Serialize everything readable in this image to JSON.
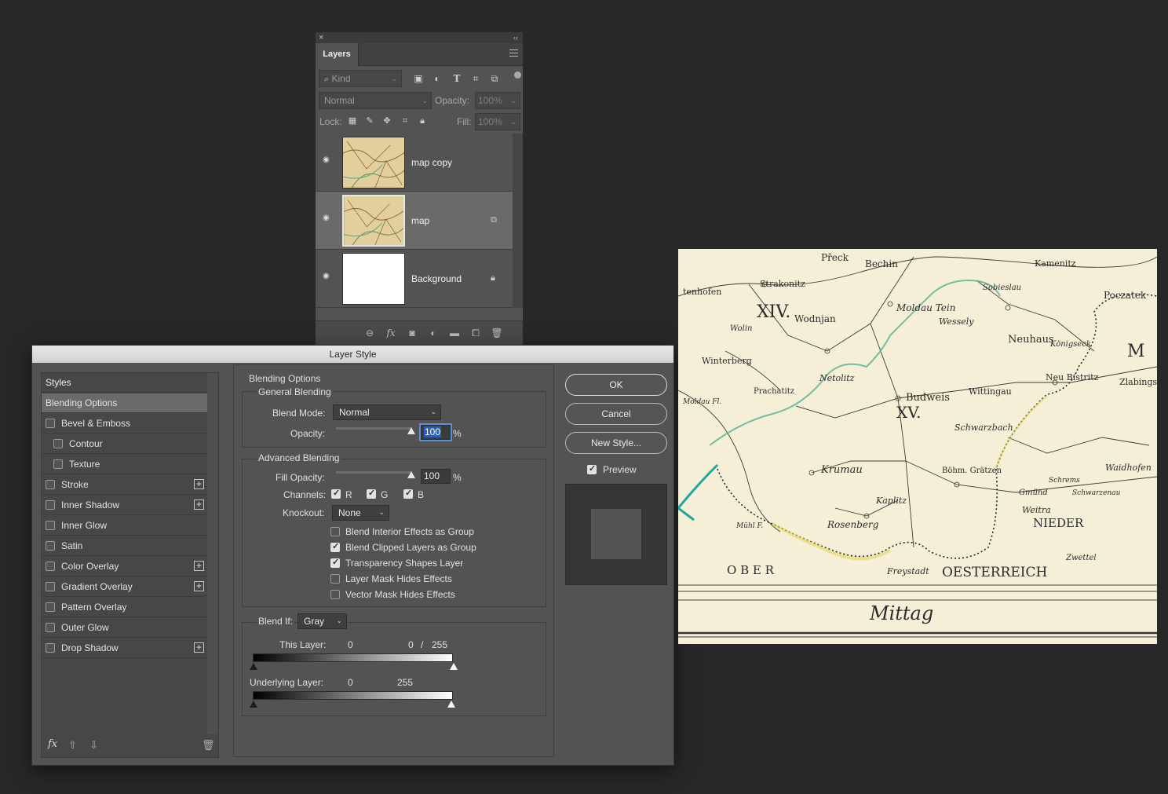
{
  "layers_panel": {
    "close_glyph": "×",
    "collapse_glyph": "‹‹",
    "tab_label": "Layers",
    "filter": {
      "label": "Kind",
      "icons": [
        "image-filter-icon",
        "adjustment-filter-icon",
        "type-filter-icon",
        "shape-filter-icon",
        "smart-object-filter-icon"
      ]
    },
    "blend_mode": "Normal",
    "opacity_label": "Opacity:",
    "opacity_value": "100%",
    "lock_label": "Lock:",
    "lock_icons": [
      "lock-transparent-pixels-icon",
      "lock-image-pixels-icon",
      "lock-position-icon",
      "lock-artboard-icon",
      "lock-all-icon"
    ],
    "fill_label": "Fill:",
    "fill_value": "100%",
    "layers": [
      {
        "name": "map copy",
        "visible": true,
        "selected": false,
        "thumb": "map"
      },
      {
        "name": "map",
        "visible": true,
        "selected": true,
        "thumb": "map",
        "badge": "smart-object-icon"
      },
      {
        "name": "Background",
        "visible": true,
        "selected": false,
        "thumb": "white",
        "badge": "lock-icon"
      }
    ],
    "footer_icons": [
      "link-layers-icon",
      "fx-icon",
      "add-mask-icon",
      "new-adjustment-icon",
      "new-group-icon",
      "new-layer-icon",
      "delete-layer-icon"
    ]
  },
  "layer_style": {
    "title": "Layer Style",
    "styles": [
      {
        "label": "Styles",
        "type": "header"
      },
      {
        "label": "Blending Options",
        "type": "active"
      },
      {
        "label": "Bevel & Emboss",
        "checkbox": true,
        "checked": false
      },
      {
        "label": "Contour",
        "checkbox": true,
        "checked": false,
        "indent": true
      },
      {
        "label": "Texture",
        "checkbox": true,
        "checked": false,
        "indent": true
      },
      {
        "label": "Stroke",
        "checkbox": true,
        "checked": false,
        "plus": true
      },
      {
        "label": "Inner Shadow",
        "checkbox": true,
        "checked": false,
        "plus": true
      },
      {
        "label": "Inner Glow",
        "checkbox": true,
        "checked": false
      },
      {
        "label": "Satin",
        "checkbox": true,
        "checked": false
      },
      {
        "label": "Color Overlay",
        "checkbox": true,
        "checked": false,
        "plus": true
      },
      {
        "label": "Gradient Overlay",
        "checkbox": true,
        "checked": false,
        "plus": true
      },
      {
        "label": "Pattern Overlay",
        "checkbox": true,
        "checked": false
      },
      {
        "label": "Outer Glow",
        "checkbox": true,
        "checked": false
      },
      {
        "label": "Drop Shadow",
        "checkbox": true,
        "checked": false,
        "plus": true
      }
    ],
    "styles_footer": {
      "fx": "fx",
      "icons": [
        "move-up-icon",
        "move-down-icon",
        "trash-icon"
      ]
    },
    "blending_options": {
      "heading": "Blending Options",
      "general": {
        "heading": "General Blending",
        "blend_mode_label": "Blend Mode:",
        "blend_mode_value": "Normal",
        "opacity_label": "Opacity:",
        "opacity_value": "100",
        "opacity_fraction": 1.0,
        "percent": "%"
      },
      "advanced": {
        "heading": "Advanced Blending",
        "fill_opacity_label": "Fill Opacity:",
        "fill_opacity_value": "100",
        "fill_fraction": 1.0,
        "percent": "%",
        "channels_label": "Channels:",
        "channels": [
          {
            "label": "R",
            "checked": true
          },
          {
            "label": "G",
            "checked": true
          },
          {
            "label": "B",
            "checked": true
          }
        ],
        "knockout_label": "Knockout:",
        "knockout_value": "None",
        "options": [
          {
            "label": "Blend Interior Effects as Group",
            "checked": false
          },
          {
            "label": "Blend Clipped Layers as Group",
            "checked": true
          },
          {
            "label": "Transparency Shapes Layer",
            "checked": true
          },
          {
            "label": "Layer Mask Hides Effects",
            "checked": false
          },
          {
            "label": "Vector Mask Hides Effects",
            "checked": false
          }
        ]
      },
      "blend_if": {
        "label": "Blend If:",
        "value": "Gray",
        "this_layer_label": "This Layer:",
        "this_layer_low": "0",
        "this_layer_high": "0",
        "this_layer_sep": "/",
        "this_layer_high2": "255",
        "underlying_label": "Underlying Layer:",
        "underlying_low": "0",
        "underlying_high": "255"
      }
    },
    "buttons": {
      "ok": "OK",
      "cancel": "Cancel",
      "new_style": "New Style..."
    },
    "preview": {
      "label": "Preview",
      "checked": true
    }
  },
  "map_canvas": {
    "labels": [
      "Přeck",
      "Bechin",
      "Kamenitz",
      "Strakonitz",
      "Sobieslau",
      "tenhofen",
      "Moldau Tein",
      "Poczatek",
      "XIV.",
      "Wodnjan",
      "Wessely",
      "Wolin",
      "Neuhaus",
      "Königseck",
      "M",
      "Winterberg",
      "Netolitz",
      "Wittingau",
      "Neu Bistritz",
      "Zlabings",
      "Prachatitz",
      "Budweis",
      "XV.",
      "Schwarzbach",
      "Moldau Fl.",
      "Krumau",
      "Böhm. Grätzen",
      "Schrems",
      "Waidhofen",
      "Gmünd",
      "Schwarzenau",
      "Kaplitz",
      "Weitra",
      "NIEDER",
      "Rosenberg",
      "Mühl F.",
      "Zwettel",
      "O B E R",
      "Freystadt",
      "OESTERREICH",
      "Mittag"
    ]
  }
}
